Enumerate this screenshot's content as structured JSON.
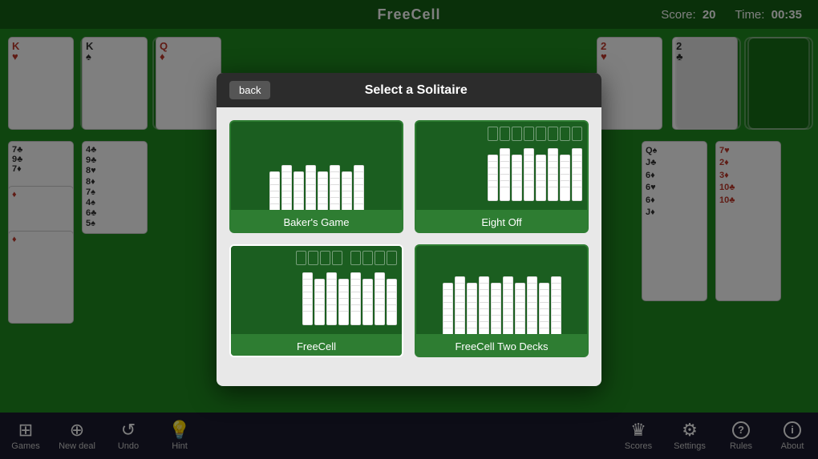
{
  "app": {
    "title": "FreeCell"
  },
  "header": {
    "title": "FreeCell",
    "score_label": "Score:",
    "score_value": "20",
    "time_label": "Time:",
    "time_value": "00:35"
  },
  "modal": {
    "back_label": "back",
    "title": "Select a Solitaire",
    "games": [
      {
        "id": "bakers-game",
        "label": "Baker's Game"
      },
      {
        "id": "eight-off",
        "label": "Eight Off"
      },
      {
        "id": "freecell",
        "label": "FreeCell"
      },
      {
        "id": "freecell-two-decks",
        "label": "FreeCell Two Decks"
      }
    ]
  },
  "toolbar": {
    "left": [
      {
        "id": "games",
        "icon": "⊞",
        "label": "Games"
      },
      {
        "id": "new-deal",
        "icon": "⊕",
        "label": "New deal"
      },
      {
        "id": "undo",
        "icon": "↺",
        "label": "Undo"
      },
      {
        "id": "hint",
        "icon": "💡",
        "label": "Hint"
      }
    ],
    "right": [
      {
        "id": "scores",
        "icon": "♛",
        "label": "Scores"
      },
      {
        "id": "settings",
        "icon": "⚙",
        "label": "Settings"
      },
      {
        "id": "rules",
        "icon": "?",
        "label": "Rules"
      },
      {
        "id": "about",
        "icon": "ℹ",
        "label": "About"
      }
    ]
  }
}
